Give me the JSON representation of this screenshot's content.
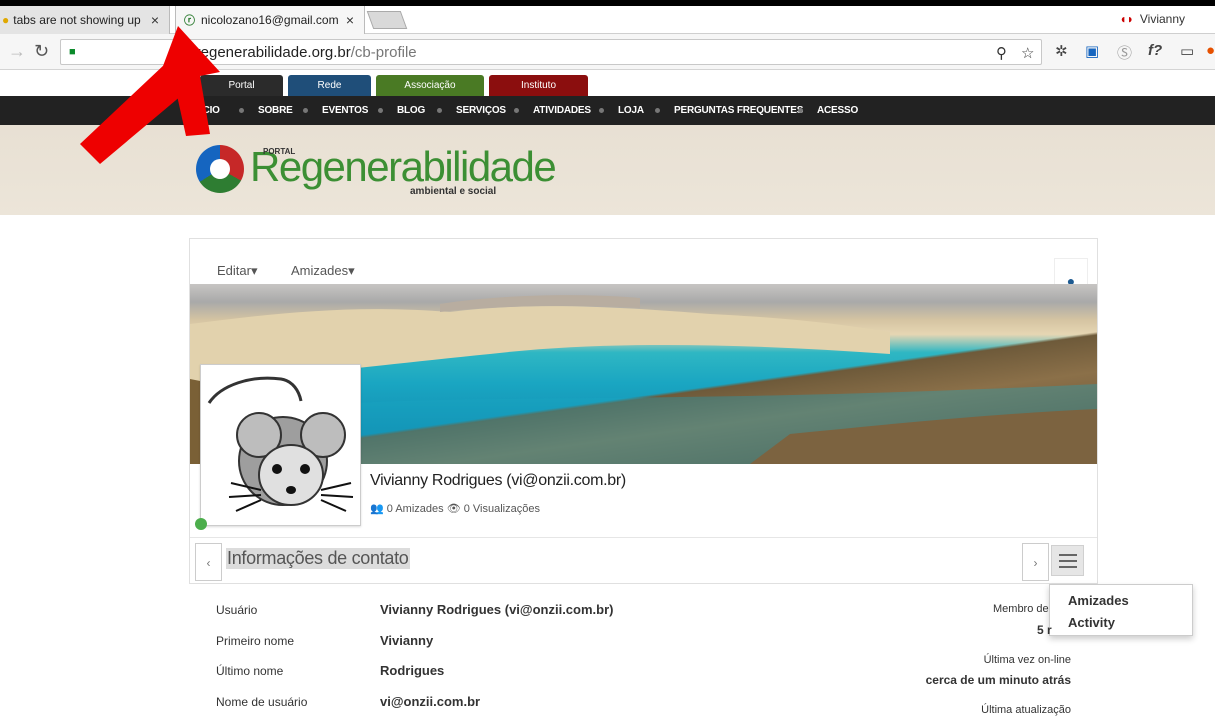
{
  "browser": {
    "tabs": [
      {
        "label": "tabs are not showing up",
        "close": "×"
      },
      {
        "label": "nicolozano16@gmail.com",
        "close": "×"
      }
    ],
    "profile_name": "Vivianny",
    "url_host": "regenerabilidade.org.br",
    "url_path": "/cb-profile",
    "icons": [
      "back-icon",
      "forward-icon",
      "reload-icon",
      "lock-icon",
      "zoom-icon",
      "star-icon"
    ]
  },
  "site": {
    "portal_tabs": [
      {
        "label": "Portal",
        "color": "#2b2b2b"
      },
      {
        "label": "Rede",
        "color": "#1f4e79"
      },
      {
        "label": "Associação",
        "color": "#4a7a24"
      },
      {
        "label": "Instituto",
        "color": "#8b0e0e"
      }
    ],
    "nav": [
      "ÍCIO",
      "SOBRE",
      "EVENTOS",
      "BLOG",
      "SERVIÇOS",
      "ATIVIDADES",
      "LOJA",
      "PERGUNTAS FREQUENTES",
      "ACESSO"
    ],
    "logo": {
      "top": "PORTAL",
      "main": "Regenerabilidade",
      "sub": "ambiental e social"
    }
  },
  "profile": {
    "menu": {
      "edit": "Editar",
      "friends": "Amizades"
    },
    "name": "Vivianny Rodrigues (vi@onzii.com.br)",
    "stats": {
      "friends": "0 Amizades",
      "views": "0 Visualizações"
    },
    "tab_title": "Informações de contato",
    "prev": "‹",
    "next": "›",
    "dropdown": [
      "Amizades",
      "Activity"
    ],
    "fields": [
      {
        "label": "Usuário",
        "value": "Vivianny Rodrigues (vi@onzii.com.br)"
      },
      {
        "label": "Primeiro nome",
        "value": "Vivianny"
      },
      {
        "label": "Último nome",
        "value": "Rodrigues"
      },
      {
        "label": "Nome de usuário",
        "value": "vi@onzii.com.br"
      }
    ],
    "side": {
      "member_label": "Membro de",
      "member_value": "5 r",
      "last_online_label": "Última vez on-line",
      "last_online_value": "cerca de um minuto atrás",
      "last_update_label": "Última atualização"
    }
  }
}
